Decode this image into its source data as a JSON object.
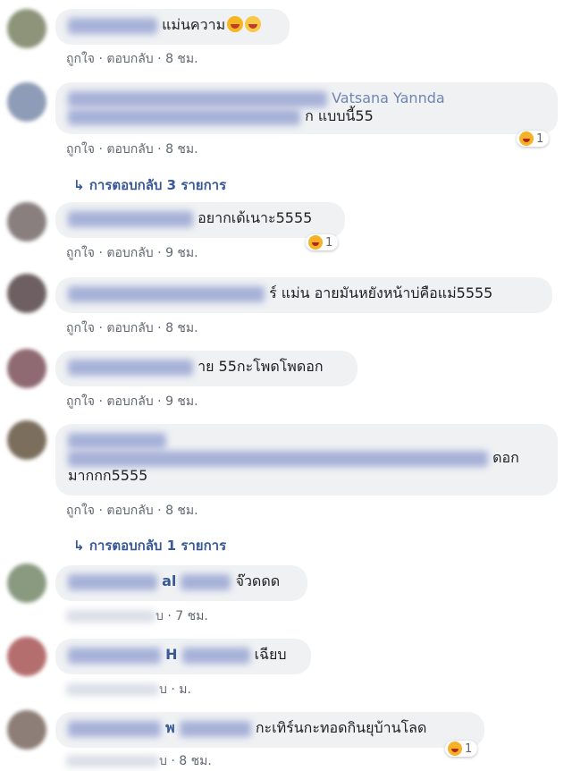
{
  "comments": [
    {
      "text": "แม่นความ",
      "meta": {
        "like": "ถูกใจ",
        "reply": "ตอบกลับ",
        "time": "8 ชม."
      }
    },
    {
      "name_fragment": "Vatsana Yannda",
      "text": "ก แบบนี้55",
      "meta": {
        "like": "ถูกใจ",
        "reply": "ตอบกลับ",
        "time": "8 ชม."
      },
      "reaction_count": "1",
      "reply_link": "การตอบกลับ 3 รายการ"
    },
    {
      "text": "อยากเด้เนาะ5555",
      "meta": {
        "like": "ถูกใจ",
        "reply": "ตอบกลับ",
        "time": "9 ชม."
      },
      "reaction_count": "1"
    },
    {
      "text": "ร์ แม่น อายมันหยังหน้าบ่คือแม่5555",
      "meta": {
        "like": "ถูกใจ",
        "reply": "ตอบกลับ",
        "time": "8 ชม."
      }
    },
    {
      "text": "าย 55กะโพดโพดอก",
      "meta": {
        "like": "ถูกใจ",
        "reply": "ตอบกลับ",
        "time": "9 ชม."
      }
    },
    {
      "text_line1": "ดอก",
      "text_line2": "มากกก5555",
      "meta": {
        "like": "ถูกใจ",
        "reply": "ตอบกลับ",
        "time": "8 ชม."
      },
      "reply_link": "การตอบกลับ 1 รายการ"
    },
    {
      "name_fragment": "al",
      "text": "จ๊วดดด",
      "meta": {
        "reply_tail": "บ",
        "time": "7 ชม."
      }
    },
    {
      "name_fragment": "H",
      "text": "เฉียบ",
      "meta": {
        "reply_tail": "บ",
        "time": "ม."
      }
    },
    {
      "name_fragment": "พ",
      "text": "กะเทิร์นกะทอดกินยุบ้านโลด",
      "meta": {
        "reply_tail": "บ",
        "time": "8 ชม."
      },
      "reaction_count": "1"
    }
  ],
  "colors": {
    "bubble": "#eff1f3",
    "link": "#385898",
    "meta": "#616770"
  }
}
